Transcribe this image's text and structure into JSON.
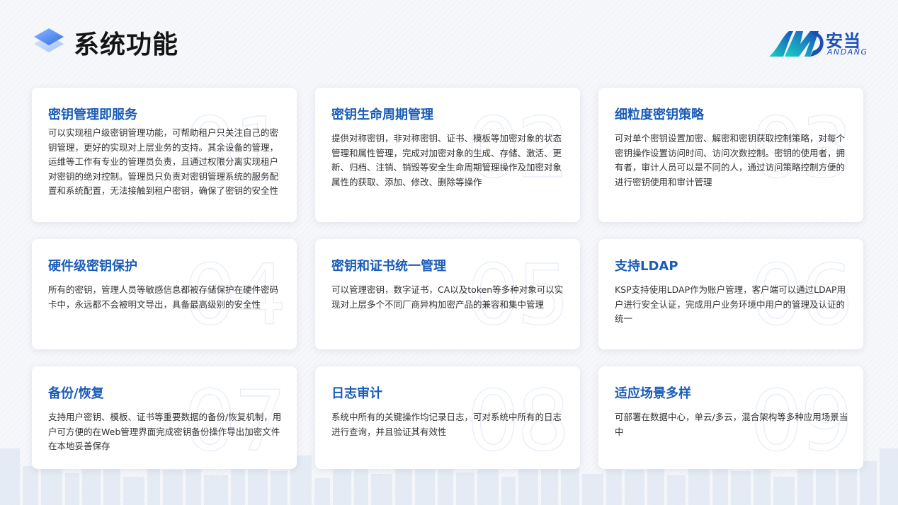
{
  "header": {
    "title": "系统功能",
    "logo_icon": "layers-stack-icon"
  },
  "brand": {
    "name_cn": "安当",
    "name_en": "ANDANG",
    "logo_icon": "andang-logo-icon"
  },
  "colors": {
    "accent": "#1a5cb8",
    "card_bg": "#ffffff",
    "title_text": "#141414"
  },
  "cards": [
    {
      "number": "01",
      "title": "密钥管理即服务",
      "desc": "可以实现租户级密钥管理功能，可帮助租户只关注自己的密钥管理，更好的实现对上层业务的支持。其余设备的管理，运维等工作有专业的管理员负责，且通过权限分离实现租户对密钥的绝对控制。管理员只负责对密钥管理系统的服务配置和系统配置，无法接触到租户密钥，确保了密钥的安全性"
    },
    {
      "number": "02",
      "title": "密钥生命周期管理",
      "desc": "提供对称密钥，非对称密钥、证书、模板等加密对象的状态管理和属性管理，完成对加密对象的生成、存储、激活、更新、归档、注销、销毁等安全生命周期管理操作及加密对象属性的获取、添加、修改、删除等操作"
    },
    {
      "number": "03",
      "title": "细粒度密钥策略",
      "desc": "可对单个密钥设置加密、解密和密钥获取控制策略，对每个密钥操作设置访问时间、访问次数控制。密钥的使用者，拥有者，审计人员可以是不同的人，通过访问策略控制方便的进行密钥使用和审计管理"
    },
    {
      "number": "04",
      "title": "硬件级密钥保护",
      "desc": "所有的密钥，管理人员等敏感信息都被存储保护在硬件密码卡中，永远都不会被明文导出，具备最高级别的安全性"
    },
    {
      "number": "05",
      "title": "密钥和证书统一管理",
      "desc": "可以管理密钥，数字证书，CA以及token等多种对象可以实现对上层多个不同厂商异构加密产品的兼容和集中管理"
    },
    {
      "number": "06",
      "title": "支持LDAP",
      "desc": "KSP支持使用LDAP作为账户管理，客户端可以通过LDAP用户进行安全认证，完成用户业务环境中用户的管理及认证的统一"
    },
    {
      "number": "07",
      "title": "备份/恢复",
      "desc": "支持用户密钥、模板、证书等重要数据的备份/恢复机制，用户可方便的在Web管理界面完成密钥备份操作导出加密文件在本地妥善保存"
    },
    {
      "number": "08",
      "title": "日志审计",
      "desc": "系统中所有的关键操作均记录日志，可对系统中所有的日志进行查询，并且验证其有效性"
    },
    {
      "number": "09",
      "title": "适应场景多样",
      "desc": "可部署在数据中心，单云/多云，混合架构等多种应用场景当中"
    }
  ]
}
